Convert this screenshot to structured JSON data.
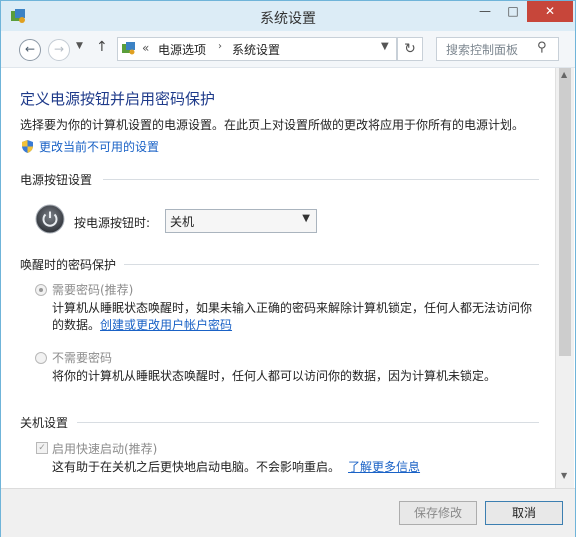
{
  "window": {
    "title": "系统设置",
    "controls": {
      "minimize": "—",
      "maximize": "□",
      "close": "✕"
    }
  },
  "navigation": {
    "back_icon": "back-arrow-icon",
    "forward_icon": "forward-arrow-icon",
    "recent_icon": "chevron-down-icon",
    "up_icon": "up-arrow-icon",
    "breadcrumb_sep": "«",
    "breadcrumb_sep2": "›",
    "breadcrumb": [
      "电源选项",
      "系统设置"
    ],
    "search_placeholder": "搜索控制面板"
  },
  "main": {
    "heading": "定义电源按钮并启用密码保护",
    "description": "选择要为你的计算机设置的电源设置。在此页上对设置所做的更改将应用于你所有的电源计划。",
    "unavailable_link": "更改当前不可用的设置",
    "power_section": {
      "title": "电源按钮设置",
      "label": "按电源按钮时:",
      "selected": "关机"
    },
    "wake_section": {
      "title": "唤醒时的密码保护",
      "options": [
        {
          "label": "需要密码(推荐)",
          "description": "计算机从睡眠状态唤醒时，如果未输入正确的密码来解除计算机锁定，任何人都无法访问你的数据。",
          "link": "创建或更改用户帐户密码",
          "selected": true
        },
        {
          "label": "不需要密码",
          "description": "将你的计算机从睡眠状态唤醒时，任何人都可以访问你的数据，因为计算机未锁定。",
          "selected": false
        }
      ]
    },
    "shutdown_section": {
      "title": "关机设置",
      "fast_startup": {
        "label": "启用快速启动(推荐)",
        "checked": true,
        "description": "这有助于在关机之后更快地启动电脑。不会影响重启。",
        "link": "了解更多信息"
      }
    }
  },
  "footer": {
    "save_label": "保存修改",
    "cancel_label": "取消"
  },
  "colors": {
    "heading": "#1e3a8a",
    "link": "#1a62c6",
    "close_button": "#c7463a",
    "titlebar": "#dcecf6"
  }
}
